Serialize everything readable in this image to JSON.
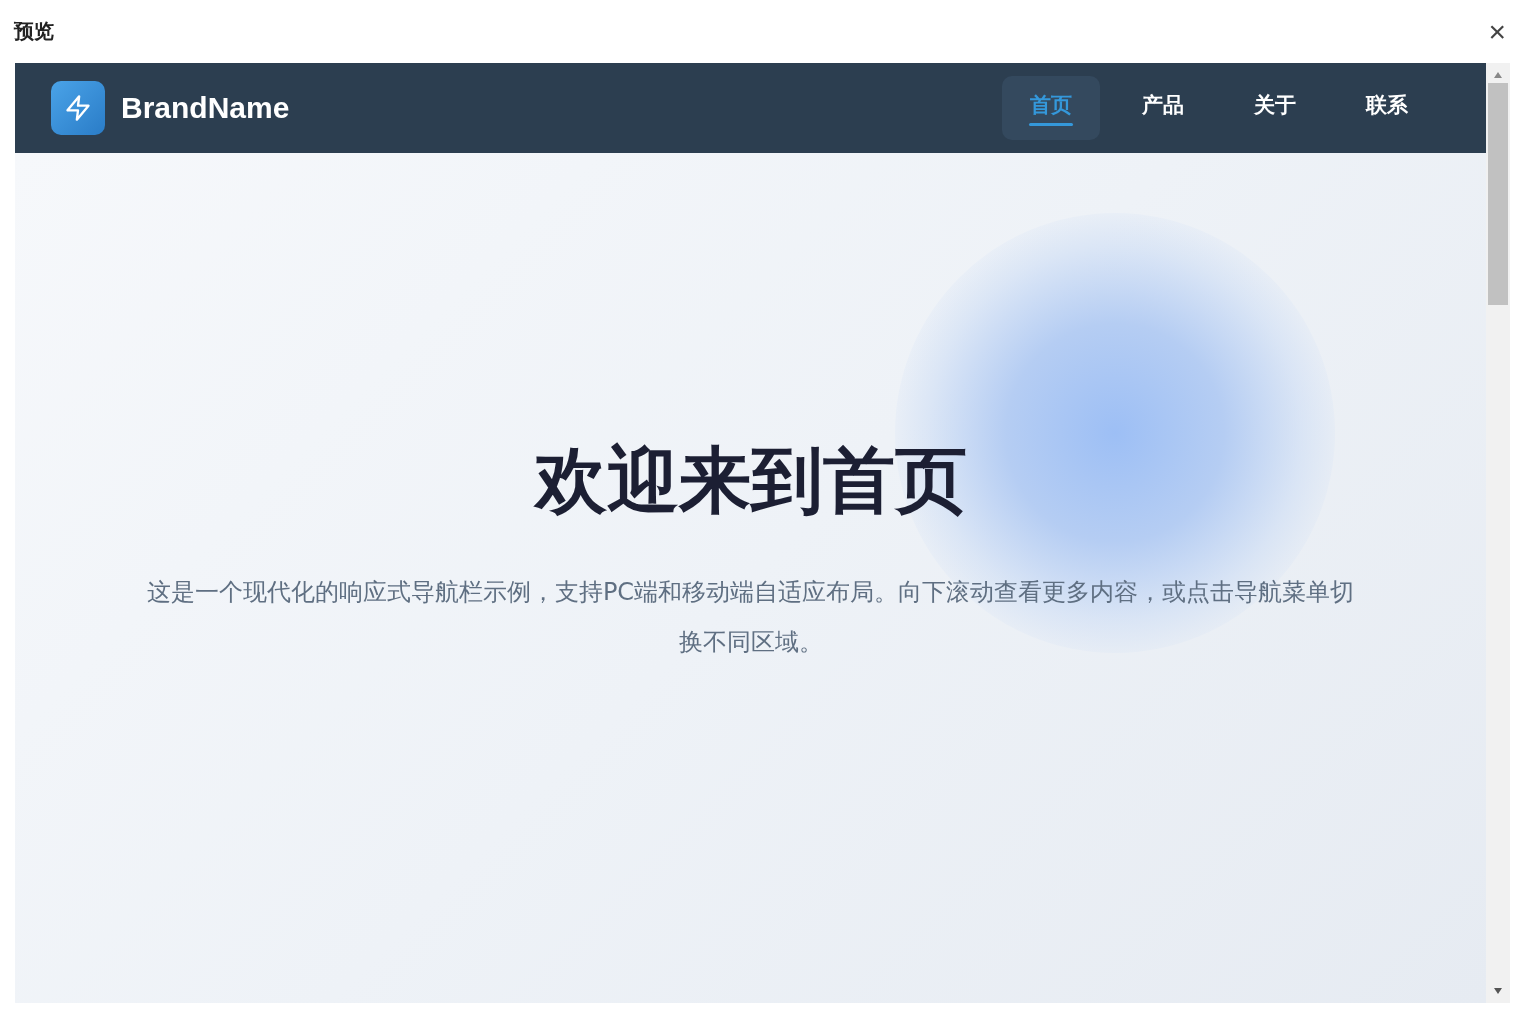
{
  "window": {
    "title": "预览",
    "close_label": "×"
  },
  "preview": {
    "brand": {
      "name": "BrandName"
    },
    "nav": {
      "items": [
        {
          "label": "首页",
          "selected": true
        },
        {
          "label": "产品",
          "selected": false
        },
        {
          "label": "关于",
          "selected": false
        },
        {
          "label": "联系",
          "selected": false
        }
      ]
    },
    "hero": {
      "title": "欢迎来到首页",
      "description": "这是一个现代化的响应式导航栏示例，支持PC端和移动端自适应布局。向下滚动查看更多内容，或点击导航菜单切换不同区域。"
    }
  }
}
